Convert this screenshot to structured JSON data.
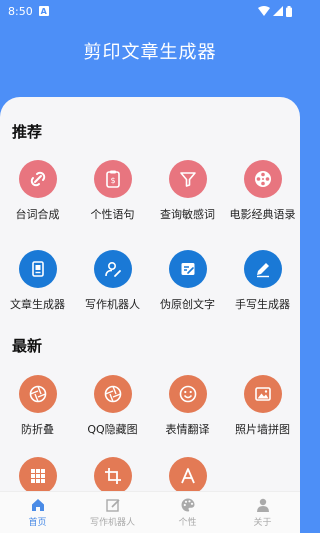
{
  "status_bar": {
    "time": "8:50",
    "notification_letter": "A"
  },
  "header": {
    "title": "剪印文章生成器"
  },
  "sections": {
    "recommended": {
      "title": "推荐",
      "items": [
        {
          "label": "台词合成",
          "icon": "link-icon"
        },
        {
          "label": "个性语句",
          "icon": "clipboard-dollar-icon"
        },
        {
          "label": "查询敏感词",
          "icon": "filter-icon"
        },
        {
          "label": "电影经典语录",
          "icon": "film-reel-icon"
        },
        {
          "label": "文章生成器",
          "icon": "document-icon"
        },
        {
          "label": "写作机器人",
          "icon": "person-pen-icon"
        },
        {
          "label": "伪原创文字",
          "icon": "edit-note-icon"
        },
        {
          "label": "手写生成器",
          "icon": "pencil-icon"
        }
      ]
    },
    "latest": {
      "title": "最新",
      "items": [
        {
          "label": "防折叠",
          "icon": "aperture-icon"
        },
        {
          "label": "QQ隐藏图",
          "icon": "aperture-icon"
        },
        {
          "label": "表情翻译",
          "icon": "smiley-icon"
        },
        {
          "label": "照片墙拼图",
          "icon": "image-icon"
        },
        {
          "label": "",
          "icon": "grid-icon"
        },
        {
          "label": "",
          "icon": "crop-icon"
        },
        {
          "label": "",
          "icon": "letter-a-icon"
        }
      ]
    }
  },
  "bottom_nav": [
    {
      "label": "首页",
      "icon": "home-icon",
      "active": true
    },
    {
      "label": "写作机器人",
      "icon": "edit-icon",
      "active": false
    },
    {
      "label": "个性",
      "icon": "palette-icon",
      "active": false
    },
    {
      "label": "关于",
      "icon": "person-icon",
      "active": false
    }
  ],
  "colors": {
    "header": "#4d8ff7",
    "pink": "#e8757f",
    "blue": "#1a79d6",
    "orange": "#e37a55",
    "nav_active": "#4a8be6"
  }
}
